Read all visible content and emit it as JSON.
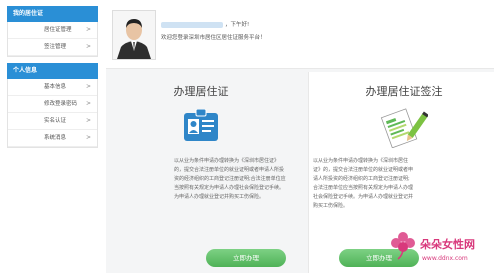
{
  "sidebar": {
    "section1_title": "我的居住证",
    "section1_items": [
      {
        "label": "居住证管理"
      },
      {
        "label": "签注管理"
      }
    ],
    "section2_title": "个人信息",
    "section2_items": [
      {
        "label": "基本信息"
      },
      {
        "label": "修改登录密码"
      },
      {
        "label": "实名认证"
      },
      {
        "label": "系统消息"
      }
    ],
    "chevron": ">"
  },
  "header": {
    "greeting_suffix": "，下午好!",
    "welcome": "欢迎您登录深圳市居住区居住证服务平台！"
  },
  "cards": [
    {
      "title": "办理居住证",
      "icon": "id-card-icon",
      "description": "以从业为条件申请办理转换为《深圳市居住证》的，提交合法注册单位的就业证明或者申请人所投资的经济组织的工商登记注册证明;合法注册单位应当按照有关规定为申请人办理社会保险登记手续。为申请人办理就业登记并购买工伤保险。",
      "button": "立即办理"
    },
    {
      "title": "办理居住证签注",
      "icon": "document-pen-icon",
      "description": "以从业为条件申请办理转换为《深圳市居住证》的，提交合法注册单位的就业证明或者申请人所投资的经济组织的工商登记注册证明;合法注册单位应当按照有关规定为申请人办理社会保险登记手续。为申请人办理就业登记并购买工伤保险。",
      "button": "立即办理"
    }
  ],
  "watermark": {
    "text": "朵朵女性网",
    "url": "www.ddnx.com"
  },
  "colors": {
    "sidebar_header": "#2a8fd6",
    "button_green": "#4fb257",
    "watermark_pink": "#d8397c"
  }
}
